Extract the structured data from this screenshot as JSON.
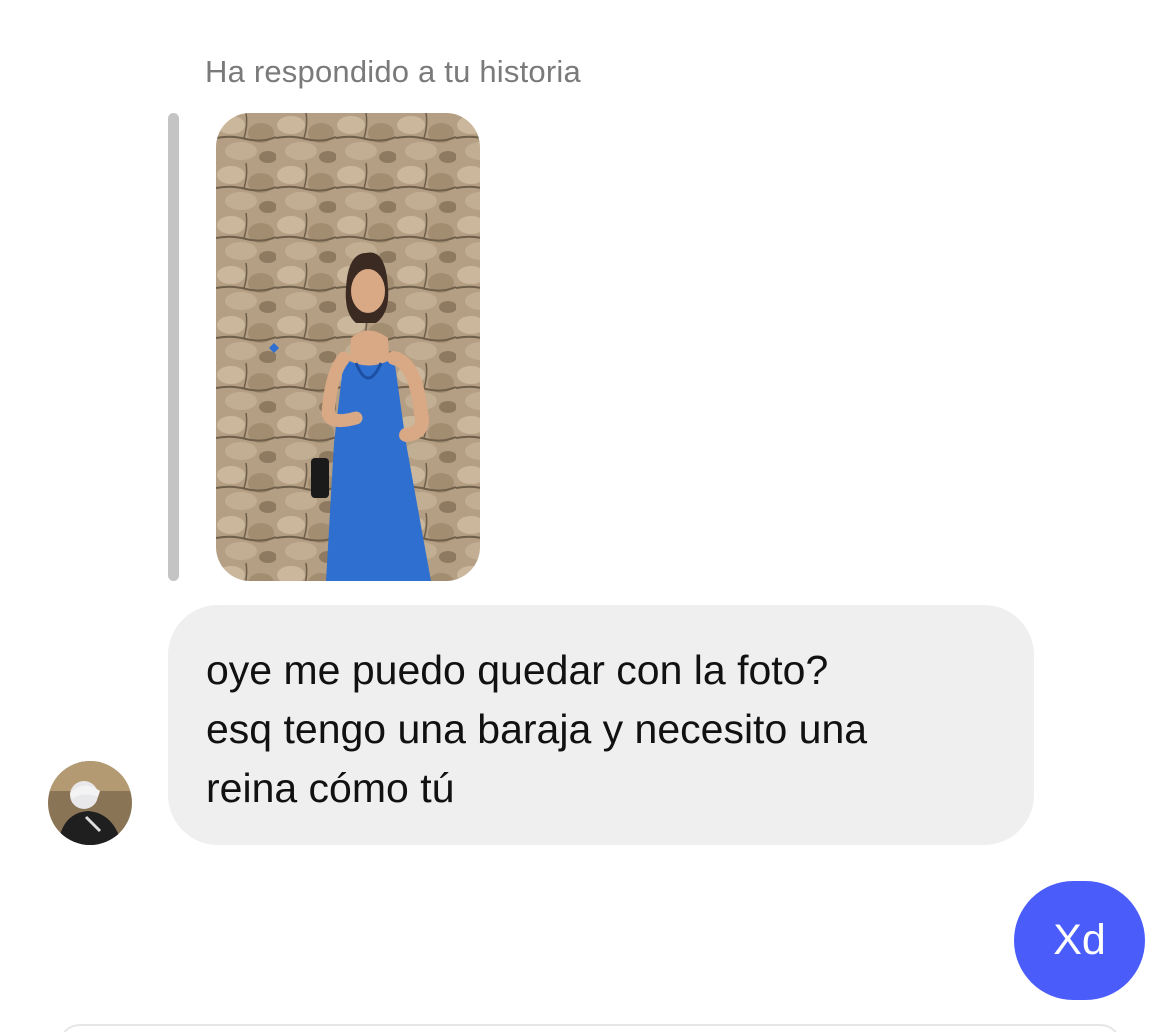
{
  "thread": {
    "reply_caption": "Ha respondido a tu historia",
    "story_image_icon": "story-photo-icon",
    "incoming_message": "oye me puedo quedar con la foto?\nesq tengo una baraja y necesito una\nreina cómo tú",
    "outgoing_message": "Xd"
  },
  "colors": {
    "outgoing_bubble": "#4a5dfb",
    "incoming_bubble": "#efefef",
    "caption_text": "#7a7a7a"
  }
}
